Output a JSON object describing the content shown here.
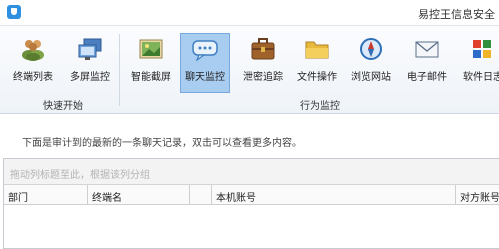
{
  "window": {
    "title": "易控王信息安全"
  },
  "ribbon": {
    "buttons": [
      {
        "label": "终端列表",
        "icon": "users-icon"
      },
      {
        "label": "多屏监控",
        "icon": "multi-screen-icon"
      },
      {
        "label": "智能截屏",
        "icon": "screenshot-icon"
      },
      {
        "label": "聊天监控",
        "icon": "chat-icon"
      },
      {
        "label": "泄密追踪",
        "icon": "briefcase-icon"
      },
      {
        "label": "文件操作",
        "icon": "folder-icon"
      },
      {
        "label": "浏览网站",
        "icon": "compass-icon"
      },
      {
        "label": "电子邮件",
        "icon": "mail-icon"
      },
      {
        "label": "软件日志",
        "icon": "software-log-icon"
      }
    ],
    "active": "聊天监控",
    "groups": [
      {
        "label": "快速开始"
      },
      {
        "label": "行为监控"
      }
    ]
  },
  "hint": "下面是审计到的最新的一条聊天记录，双击可以查看更多内容。",
  "table": {
    "group_placeholder": "拖动列标题至此，根据该列分组",
    "columns": [
      "部门",
      "终端名",
      "",
      "本机账号",
      "对方账号"
    ]
  }
}
